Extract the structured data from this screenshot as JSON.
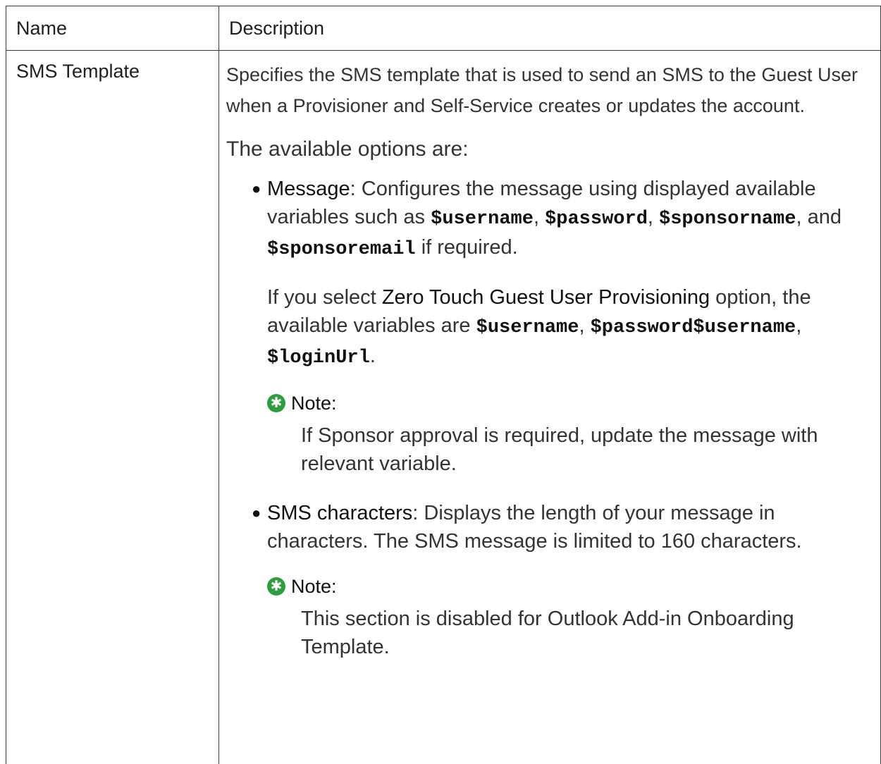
{
  "table": {
    "headers": {
      "name": "Name",
      "description": "Description"
    },
    "row": {
      "name": "SMS Template",
      "intro": "Specifies the SMS template that is used to send an SMS to the Guest User when a Provisioner and Self-Service creates or updates the account.",
      "available": "The available options are:",
      "option1": {
        "term": "Message",
        "t1": ": Configures the message using displayed available variables such as ",
        "v1": "$username",
        "t2": ", ",
        "v2": "$password",
        "t3": ", ",
        "v3": "$sponsorname",
        "t4": ", and ",
        "v4": "$sponsoremail",
        "t5": " if required.",
        "sub": {
          "t1": "If you select ",
          "term": "Zero Touch Guest User Provisioning",
          "t2": " option, the available variables are ",
          "v1": "$username",
          "t3": ", ",
          "v2": "$password$username",
          "t4": ", ",
          "v3": "$loginUrl",
          "t5": "."
        },
        "note": {
          "label": "Note:",
          "text": "If Sponsor approval is required, update the message with relevant variable."
        }
      },
      "option2": {
        "term": "SMS characters",
        "text": ": Displays the length of your message in characters. The SMS message is limited to 160 characters.",
        "note": {
          "label": "Note:",
          "text": "This section is disabled for Outlook Add-in Onboarding Template."
        }
      }
    }
  },
  "icons": {
    "note": "note-star-icon",
    "bullet": "bullet-dot-icon"
  },
  "colors": {
    "note_icon": "#2e9e3c",
    "border": "#3a3a3a",
    "text": "#1f1f1f"
  }
}
